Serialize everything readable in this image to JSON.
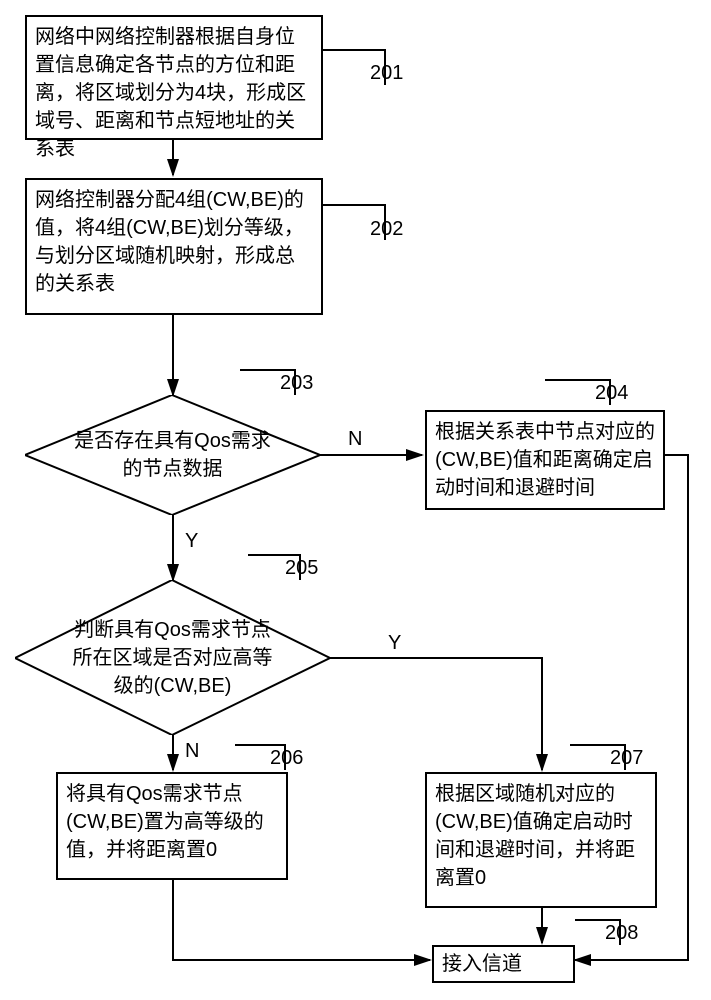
{
  "steps": {
    "s201": {
      "num": "201",
      "text": "网络中网络控制器根据自身位置信息确定各节点的方位和距离，将区域划分为4块，形成区域号、距离和节点短地址的关系表"
    },
    "s202": {
      "num": "202",
      "text": "网络控制器分配4组(CW,BE)的值，将4组(CW,BE)划分等级，与划分区域随机映射，形成总的关系表"
    },
    "s203": {
      "num": "203",
      "text": "是否存在具有Qos需求的节点数据"
    },
    "s204": {
      "num": "204",
      "text": "根据关系表中节点对应的(CW,BE)值和距离确定启动时间和退避时间"
    },
    "s205": {
      "num": "205",
      "text": "判断具有Qos需求节点所在区域是否对应高等级的(CW,BE)"
    },
    "s206": {
      "num": "206",
      "text": "将具有Qos需求节点(CW,BE)置为高等级的值，并将距离置0"
    },
    "s207": {
      "num": "207",
      "text": "根据区域随机对应的(CW,BE)值确定启动时间和退避时间，并将距离置0"
    },
    "s208": {
      "num": "208",
      "text": "接入信道"
    }
  },
  "labels": {
    "yes": "Y",
    "no": "N"
  }
}
